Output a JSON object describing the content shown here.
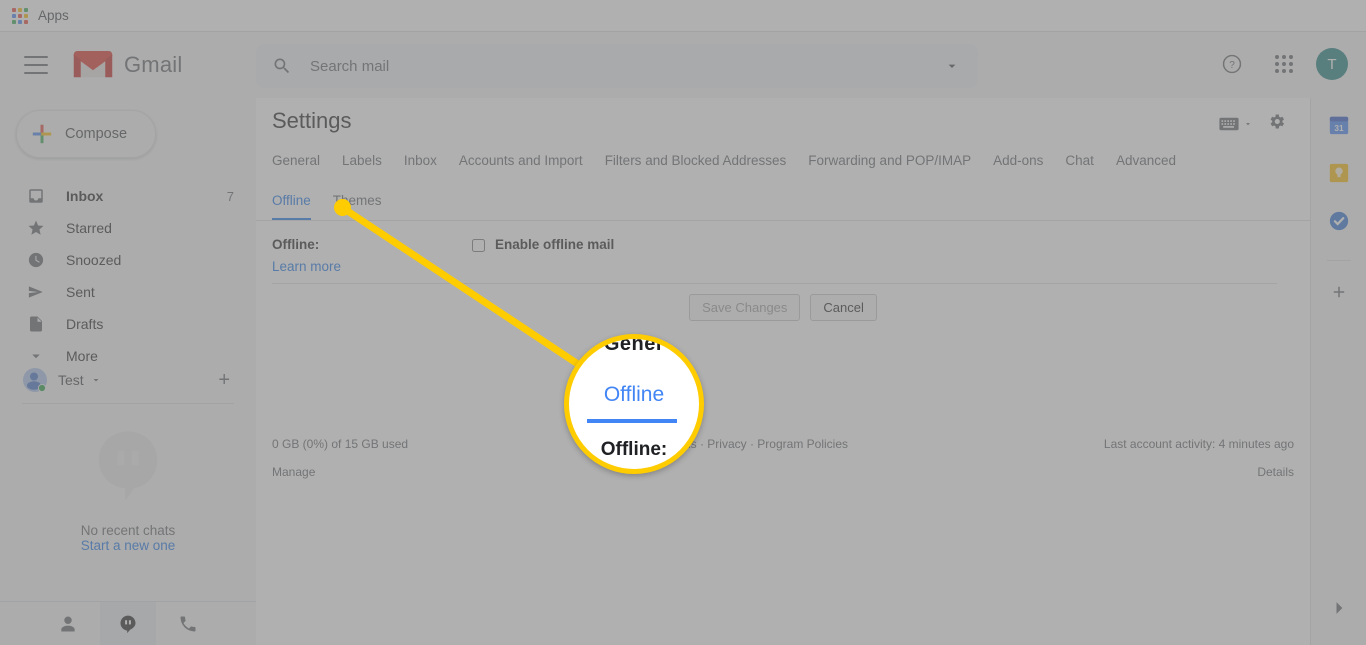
{
  "browser": {
    "bookmark_label": "Apps",
    "apps_icon": "apps-grid-icon"
  },
  "header": {
    "menu_icon": "hamburger-menu-icon",
    "logo_icon": "gmail-m-logo-icon",
    "brand": "Gmail",
    "search": {
      "icon": "search-icon",
      "placeholder": "Search mail",
      "value": "",
      "options_icon": "chevron-down-icon"
    },
    "help_icon": "help-circle-icon",
    "apps_icon": "google-apps-grid-icon",
    "avatar_initial": "T"
  },
  "sidebar": {
    "compose": {
      "label": "Compose",
      "icon": "plus-icon"
    },
    "items": [
      {
        "label": "Inbox",
        "icon": "inbox-icon",
        "count": "7",
        "active": true
      },
      {
        "label": "Starred",
        "icon": "star-icon",
        "count": "",
        "active": false
      },
      {
        "label": "Snoozed",
        "icon": "clock-icon",
        "count": "",
        "active": false
      },
      {
        "label": "Sent",
        "icon": "send-icon",
        "count": "",
        "active": false
      },
      {
        "label": "Drafts",
        "icon": "draft-icon",
        "count": "",
        "active": false
      },
      {
        "label": "More",
        "icon": "chevron-down-icon",
        "count": "",
        "active": false
      }
    ],
    "account": {
      "name": "Test",
      "avatar_icon": "contact-avatar-icon",
      "dropdown_icon": "caret-down-icon",
      "add_icon": "plus-icon"
    },
    "chat": {
      "empty_icon": "hangouts-bubble-icon",
      "empty_text": "No recent chats",
      "start_link": "Start a new one",
      "tabs": [
        {
          "icon": "person-icon",
          "selected": false
        },
        {
          "icon": "hangouts-icon",
          "selected": true
        },
        {
          "icon": "phone-icon",
          "selected": false
        }
      ]
    }
  },
  "settings": {
    "title": "Settings",
    "keyboard_icon": "keyboard-icon",
    "keyboard_caret_icon": "caret-down-icon",
    "gear_icon": "gear-icon",
    "tabs_row1": [
      {
        "label": "General",
        "selected": false
      },
      {
        "label": "Labels",
        "selected": false
      },
      {
        "label": "Inbox",
        "selected": false
      },
      {
        "label": "Accounts and Import",
        "selected": false
      },
      {
        "label": "Filters and Blocked Addresses",
        "selected": false
      },
      {
        "label": "Forwarding and POP/IMAP",
        "selected": false
      },
      {
        "label": "Add-ons",
        "selected": false
      },
      {
        "label": "Chat",
        "selected": false
      },
      {
        "label": "Advanced",
        "selected": false
      }
    ],
    "tabs_row2": [
      {
        "label": "Offline",
        "selected": true
      },
      {
        "label": "Themes",
        "selected": false
      }
    ],
    "offline_option": {
      "label": "Offline:",
      "learn_more": "Learn more",
      "checkbox_label": "Enable offline mail",
      "checked": false
    },
    "save_label": "Save Changes",
    "save_disabled": true,
    "cancel_label": "Cancel"
  },
  "footer": {
    "storage": "0 GB (0%) of 15 GB used",
    "manage": "Manage",
    "policies": "Terms · Privacy · Program Policies",
    "activity": "Last account activity: 4 minutes ago",
    "details": "Details"
  },
  "rail": {
    "items": [
      {
        "icon": "google-calendar-icon",
        "label": "31"
      },
      {
        "icon": "google-keep-icon",
        "label": ""
      },
      {
        "icon": "google-tasks-icon",
        "label": ""
      }
    ],
    "add_icon": "plus-icon",
    "expand_icon": "chevron-right-icon"
  },
  "callout": {
    "magnifier": {
      "top_text": "Gener",
      "highlight_text": "Offline",
      "bottom_text": "Offline:"
    },
    "accent_color": "#ffcc00"
  }
}
